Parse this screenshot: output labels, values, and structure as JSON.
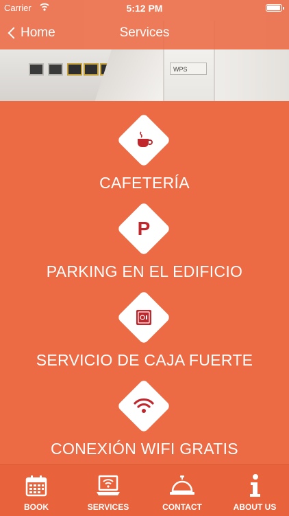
{
  "status_bar": {
    "carrier": "Carrier",
    "time": "5:12 PM"
  },
  "nav": {
    "back_label": "Home",
    "title": "Services"
  },
  "hero": {
    "wps_label": "WPS"
  },
  "services": [
    {
      "label": "CAFETERÍA",
      "icon": "coffee-cup-icon"
    },
    {
      "label": "PARKING EN EL EDIFICIO",
      "icon": "parking-icon",
      "icon_text": "P"
    },
    {
      "label": "SERVICIO DE CAJA FUERTE",
      "icon": "safe-icon"
    },
    {
      "label": "CONEXIÓN WIFI GRATIS",
      "icon": "wifi-icon"
    }
  ],
  "tabs": [
    {
      "label": "BOOK",
      "icon": "calendar-icon"
    },
    {
      "label": "SERVICES",
      "icon": "laptop-wifi-icon"
    },
    {
      "label": "CONTACT",
      "icon": "service-bell-icon"
    },
    {
      "label": "ABOUT US",
      "icon": "info-icon"
    }
  ],
  "colors": {
    "accent": "#ec6a44",
    "icon_red": "#c0272d",
    "white": "#ffffff"
  }
}
